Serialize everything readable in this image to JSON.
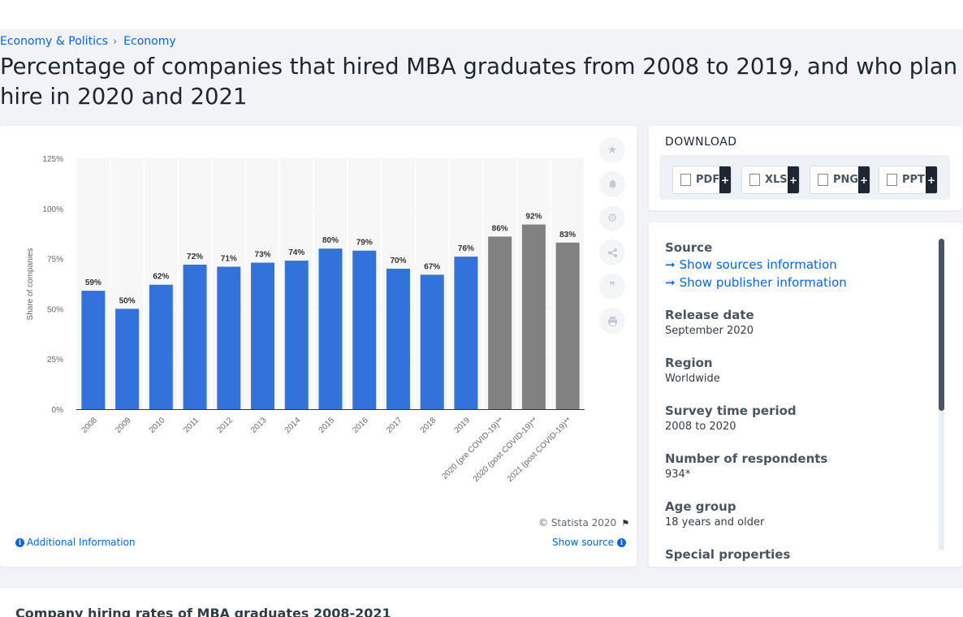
{
  "breadcrumb": {
    "item1": "Economy & Politics",
    "item2": "Economy",
    "separator": "›"
  },
  "page_title": "Percentage of companies that hired MBA graduates from 2008 to 2019, and who plan hire in 2020 and 2021",
  "chart_tools": [
    "star-icon",
    "bell-icon",
    "gear-icon",
    "share-icon",
    "quote-icon",
    "print-icon"
  ],
  "chart_footer": {
    "copyright": "© Statista 2020",
    "additional_info": "Additional Information",
    "show_source": "Show source"
  },
  "download": {
    "title": "DOWNLOAD",
    "buttons": [
      {
        "label": "PDF",
        "plus": "+",
        "color": "#e53935"
      },
      {
        "label": "XLS",
        "plus": "+",
        "color": "#43a047"
      },
      {
        "label": "PNG",
        "plus": "+",
        "color": "#1e88e5"
      },
      {
        "label": "PPT",
        "plus": "+",
        "color": "#fb8c00"
      }
    ]
  },
  "meta": {
    "source_label": "Source",
    "show_sources": "Show sources information",
    "show_publisher": "Show publisher information",
    "release_label": "Release date",
    "release_value": "September 2020",
    "region_label": "Region",
    "region_value": "Worldwide",
    "survey_label": "Survey time period",
    "survey_value": "2008 to 2020",
    "respondents_label": "Number of respondents",
    "respondents_value": "934*",
    "age_label": "Age group",
    "age_value": "18 years and older",
    "special_label": "Special properties"
  },
  "bottom_title": "Company hiring rates of MBA graduates 2008-2021",
  "chart_data": {
    "type": "bar",
    "ylabel": "Share of companies",
    "xlabel": "",
    "ylim": [
      0,
      125
    ],
    "yticks": [
      0,
      25,
      50,
      75,
      100,
      125
    ],
    "ytick_labels": [
      "0%",
      "25%",
      "50%",
      "75%",
      "100%",
      "125%"
    ],
    "grid": false,
    "categories": [
      "2008",
      "2009",
      "2010",
      "2011",
      "2012",
      "2013",
      "2014",
      "2015",
      "2016",
      "2017",
      "2018",
      "2019",
      "2020 (pre COVID-19)**",
      "2020 (post COVID-19)**",
      "2021 (post COVID-19)**"
    ],
    "values": [
      59,
      50,
      62,
      72,
      71,
      73,
      74,
      80,
      79,
      70,
      67,
      76,
      86,
      92,
      83
    ],
    "data_labels": [
      "59%",
      "50%",
      "62%",
      "72%",
      "71%",
      "73%",
      "74%",
      "80%",
      "79%",
      "70%",
      "67%",
      "76%",
      "86%",
      "92%",
      "83%"
    ],
    "colors": [
      "#3173db",
      "#3173db",
      "#3173db",
      "#3173db",
      "#3173db",
      "#3173db",
      "#3173db",
      "#3173db",
      "#3173db",
      "#3173db",
      "#3173db",
      "#3173db",
      "#818181",
      "#818181",
      "#818181"
    ]
  }
}
